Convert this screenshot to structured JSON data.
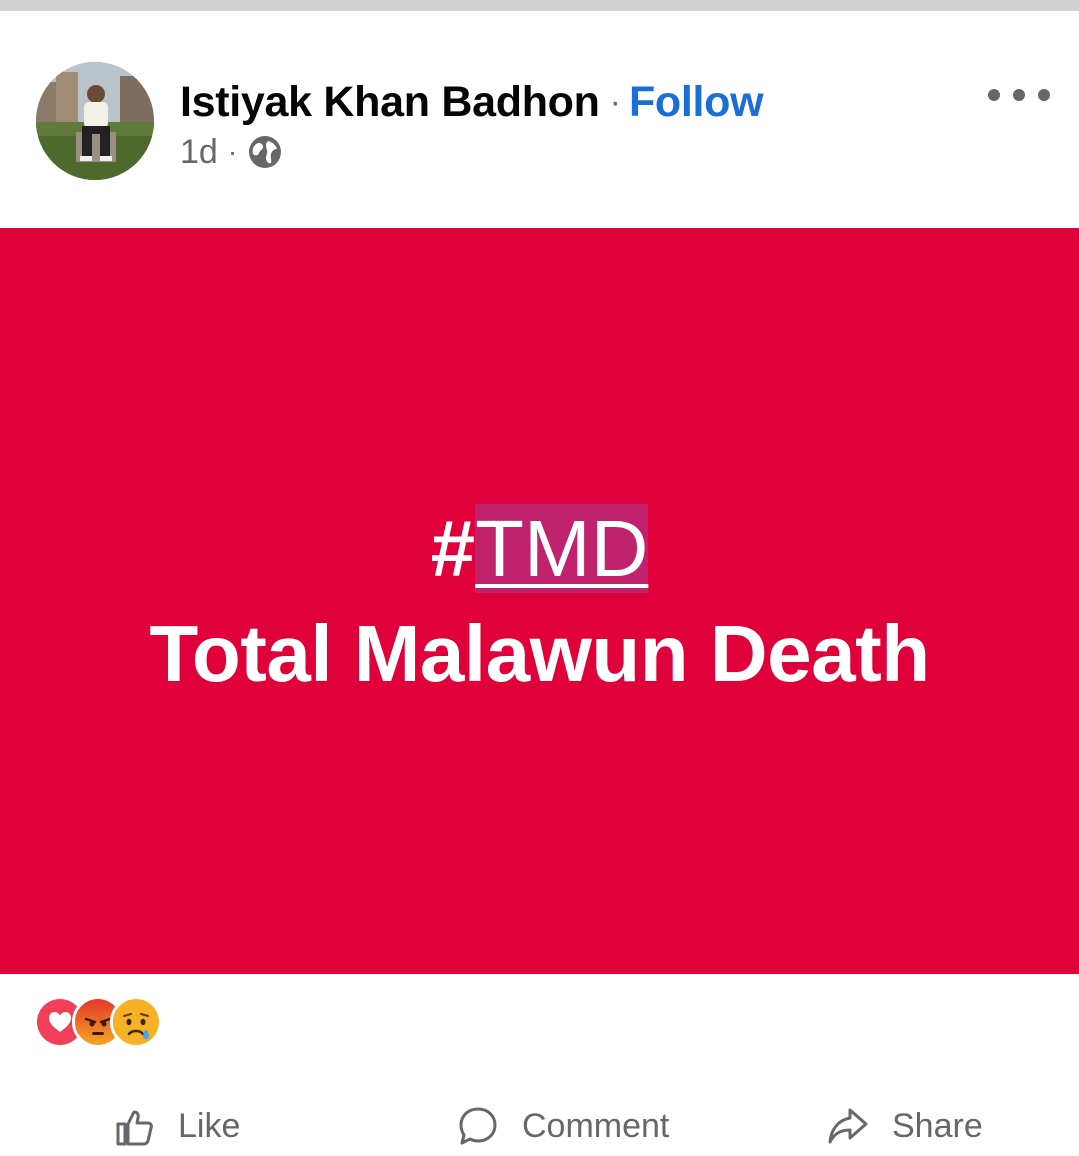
{
  "post": {
    "author": "Istiyak Khan Badhon",
    "separator": "·",
    "follow_label": "Follow",
    "time": "1d",
    "time_separator": "·",
    "audience_icon": "globe-icon",
    "more_icon": "more-dots-icon"
  },
  "card": {
    "hash": "#",
    "tag": "TMD",
    "subtitle": "Total Malawun Death",
    "background": "#e0003a",
    "tag_highlight": "#c0226d"
  },
  "reactions": [
    {
      "icon": "love-reaction-icon",
      "color": "#f33e58"
    },
    {
      "icon": "angry-reaction-icon",
      "color": "#e9710f"
    },
    {
      "icon": "sad-reaction-icon",
      "color": "#f7b125"
    }
  ],
  "actions": [
    {
      "icon": "like-icon",
      "label": "Like"
    },
    {
      "icon": "comment-icon",
      "label": "Comment"
    },
    {
      "icon": "share-icon",
      "label": "Share"
    }
  ],
  "colors": {
    "link": "#1a6ed8",
    "secondary_text": "#65676b",
    "divider": "#ced0d4"
  }
}
